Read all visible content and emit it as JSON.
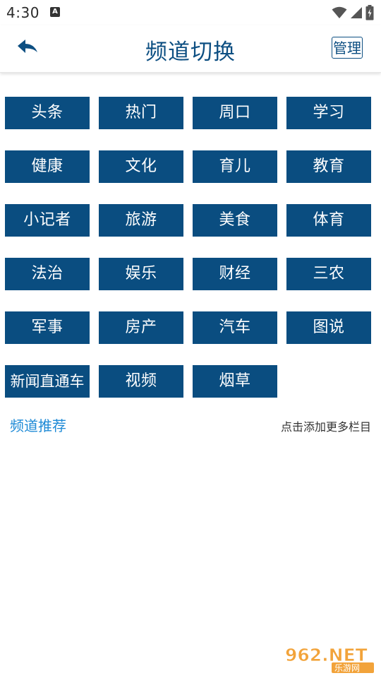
{
  "status_bar": {
    "time": "4:30",
    "notification_letter": "A"
  },
  "header": {
    "title": "频道切换",
    "manage_label": "管理"
  },
  "channels": [
    "头条",
    "热门",
    "周口",
    "学习",
    "健康",
    "文化",
    "育儿",
    "教育",
    "小记者",
    "旅游",
    "美食",
    "体育",
    "法治",
    "娱乐",
    "财经",
    "三农",
    "军事",
    "房产",
    "汽车",
    "图说",
    "新闻直通车",
    "视频",
    "烟草"
  ],
  "recommend": {
    "label": "频道推荐",
    "hint": "点击添加更多栏目"
  },
  "watermark": {
    "brand": "962.NET",
    "sub": "乐游网"
  },
  "colors": {
    "brand_blue": "#0a4d80",
    "link_blue": "#1e8ad6"
  }
}
